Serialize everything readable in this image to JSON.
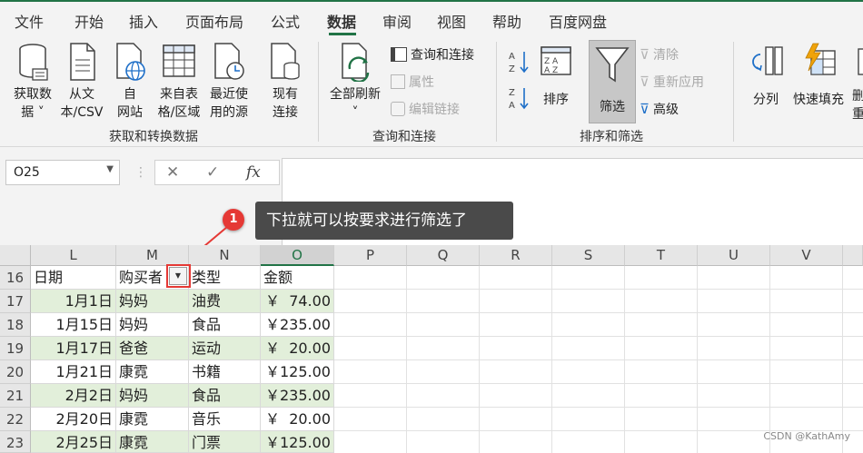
{
  "menu": {
    "items": [
      "文件",
      "开始",
      "插入",
      "页面布局",
      "公式",
      "数据",
      "审阅",
      "视图",
      "帮助",
      "百度网盘"
    ],
    "active": "数据"
  },
  "ribbon": {
    "get_data_group": {
      "label": "获取和转换数据",
      "buttons": [
        {
          "line1": "获取数",
          "line2": "据 ˅"
        },
        {
          "line1": "从文",
          "line2": "本/CSV"
        },
        {
          "line1": "自",
          "line2": "网站"
        },
        {
          "line1": "来自表",
          "line2": "格/区域"
        },
        {
          "line1": "最近使",
          "line2": "用的源"
        },
        {
          "line1": "现有",
          "line2": "连接"
        }
      ]
    },
    "query_group": {
      "label": "查询和连接",
      "refresh_line1": "全部刷新",
      "refresh_line2": "˅",
      "queries": "查询和连接",
      "properties": "属性",
      "edit_links": "编辑链接"
    },
    "sort_group": {
      "label": "排序和筛选",
      "sort": "排序",
      "filter": "筛选",
      "clear": "清除",
      "reapply": "重新应用",
      "advanced": "高级"
    },
    "tools_group": {
      "split": "分列",
      "flash_fill": "快速填充",
      "partial1": "删",
      "partial2": "重"
    }
  },
  "formula_bar": {
    "name_box": "O25",
    "cancel_symbol": "✕",
    "enter_symbol": "✓",
    "fx_symbol": "fx",
    "value": ""
  },
  "callout": {
    "badge": "1",
    "text": "下拉就可以按要求进行筛选了"
  },
  "sheet": {
    "columns": [
      "L",
      "M",
      "N",
      "O",
      "P",
      "Q",
      "R",
      "S",
      "T",
      "U",
      "V"
    ],
    "selected_column": "O",
    "header_row": {
      "row": "16",
      "cells": [
        "日期",
        "购买者",
        "类型",
        "金额"
      ]
    },
    "rows": [
      {
        "row": "17",
        "date": "1月1日",
        "buyer": "妈妈",
        "type": "油费",
        "amount": "￥  74.00"
      },
      {
        "row": "18",
        "date": "1月15日",
        "buyer": "妈妈",
        "type": "食品",
        "amount": "￥235.00"
      },
      {
        "row": "19",
        "date": "1月17日",
        "buyer": "爸爸",
        "type": "运动",
        "amount": "￥  20.00"
      },
      {
        "row": "20",
        "date": "1月21日",
        "buyer": "康霓",
        "type": "书籍",
        "amount": "￥125.00"
      },
      {
        "row": "21",
        "date": "2月2日",
        "buyer": "妈妈",
        "type": "食品",
        "amount": "￥235.00"
      },
      {
        "row": "22",
        "date": "2月20日",
        "buyer": "康霓",
        "type": "音乐",
        "amount": "￥  20.00"
      },
      {
        "row": "23",
        "date": "2月25日",
        "buyer": "康霓",
        "type": "门票",
        "amount": "￥125.00"
      }
    ]
  },
  "watermark": "CSDN @KathAmy",
  "colors": {
    "accent": "#217346",
    "callout_red": "#e53935",
    "band_green": "#e2efda"
  }
}
